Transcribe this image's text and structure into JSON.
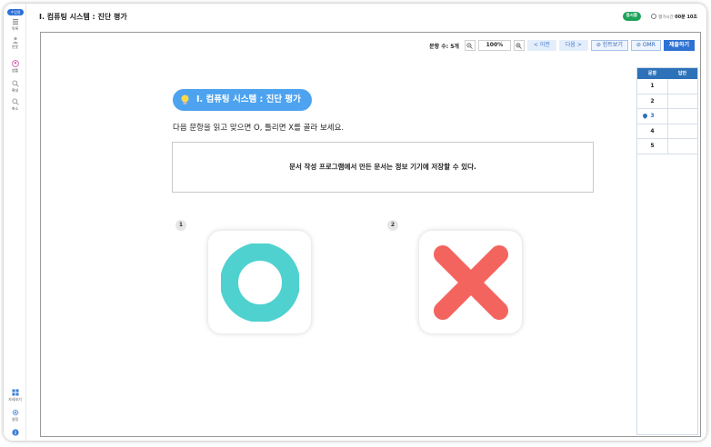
{
  "sidebar": {
    "badge": "수업용",
    "items": [
      {
        "label": "목록",
        "icon": "list-icon"
      },
      {
        "label": "연못",
        "icon": "people-icon"
      },
      {
        "label": "앱툴",
        "icon": "user-icon"
      },
      {
        "label": "확대",
        "icon": "zoom-in-icon"
      },
      {
        "label": "축소",
        "icon": "zoom-out-icon"
      }
    ],
    "bottom_items": [
      {
        "label": "자세보기",
        "icon": "grid-icon"
      },
      {
        "label": "설정",
        "icon": "gear-icon"
      },
      {
        "label": "",
        "icon": "info-icon"
      }
    ]
  },
  "header": {
    "title": "I. 컴퓨팅 시스템 : 진단 평가",
    "status": "응시중",
    "timer_label": "평가시간",
    "timer_value": "00분 10초"
  },
  "toolbar": {
    "count_label": "문항 수: 5개",
    "zoom_value": "100%",
    "prev_label": "< 이전",
    "next_label": "다음 >",
    "hint_label": "⊘ 힌트보기",
    "omr_label": "⊘ OMR",
    "submit_label": "제출하기"
  },
  "question": {
    "title": "I. 컴퓨팅 시스템 : 진단 평가",
    "instruction": "다음 문항을 읽고 맞으면 O, 틀리면 X를 골라 보세요.",
    "statement": "문서 작성 프로그램에서 만든 문서는 정보 기기에 저장할 수 있다.",
    "choices": [
      {
        "number": "1",
        "symbol": "O",
        "color": "#4fd1cf"
      },
      {
        "number": "2",
        "symbol": "X",
        "color": "#f4645f"
      }
    ]
  },
  "answer_table": {
    "headers": [
      "문항",
      "답안"
    ],
    "rows": [
      {
        "q": "1",
        "a": ""
      },
      {
        "q": "2",
        "a": ""
      },
      {
        "q": "3",
        "a": "",
        "current": true
      },
      {
        "q": "4",
        "a": ""
      },
      {
        "q": "5",
        "a": ""
      }
    ]
  },
  "colors": {
    "accent": "#2e72d2",
    "status_green": "#1ea35a",
    "title_pill": "#4da3ef"
  }
}
